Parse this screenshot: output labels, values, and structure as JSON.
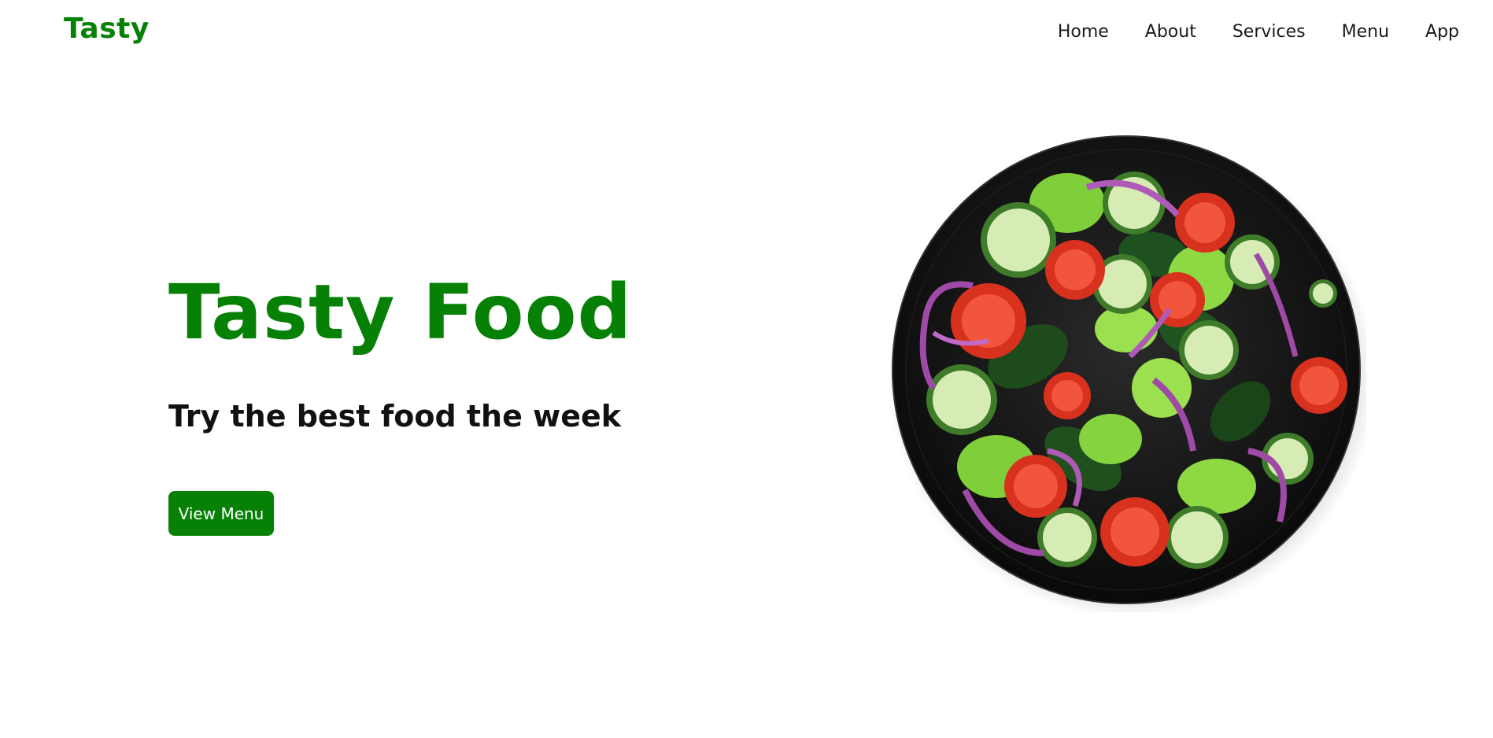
{
  "header": {
    "logo": "Tasty",
    "nav": [
      {
        "label": "Home"
      },
      {
        "label": "About"
      },
      {
        "label": "Services"
      },
      {
        "label": "Menu"
      },
      {
        "label": "App"
      }
    ]
  },
  "hero": {
    "title": "Tasty Food",
    "subtitle": "Try the best food the week",
    "button_label": "View Menu"
  },
  "colors": {
    "brand_green": "#068106",
    "text": "#111111",
    "plate": "#141414"
  },
  "icons": {
    "hero_image": "salad-bowl-image"
  }
}
